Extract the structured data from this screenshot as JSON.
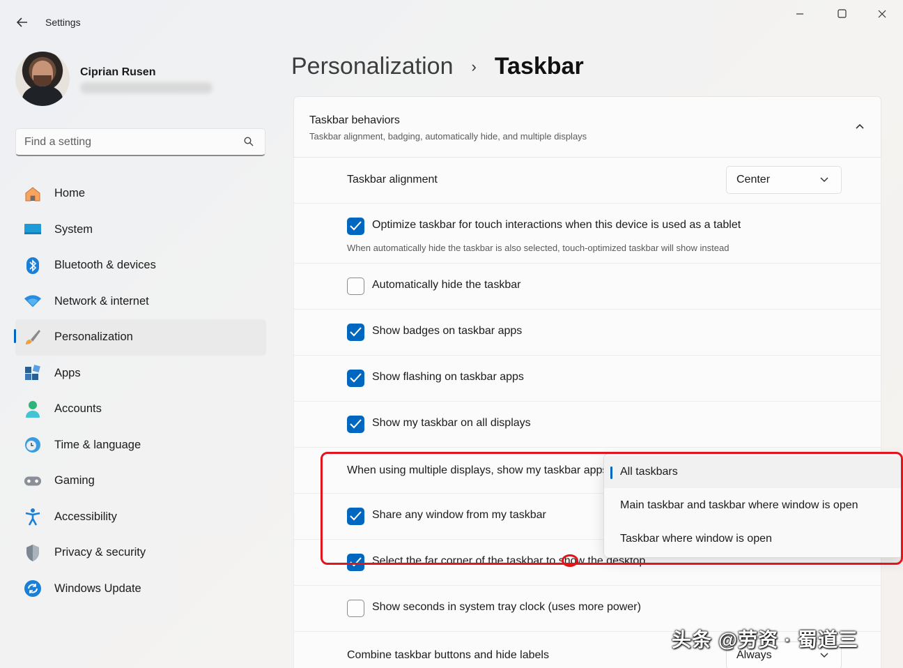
{
  "window": {
    "app_title": "Settings",
    "back_icon": "arrow-left-icon",
    "controls": [
      "minimize-icon",
      "maximize-icon",
      "close-icon"
    ]
  },
  "profile": {
    "name": "Ciprian Rusen"
  },
  "search": {
    "placeholder": "Find a setting",
    "value": ""
  },
  "sidebar": {
    "items": [
      {
        "label": "Home",
        "icon": "home-icon"
      },
      {
        "label": "System",
        "icon": "monitor-icon"
      },
      {
        "label": "Bluetooth & devices",
        "icon": "bluetooth-icon"
      },
      {
        "label": "Network & internet",
        "icon": "wifi-icon"
      },
      {
        "label": "Personalization",
        "icon": "paintbrush-icon",
        "active": true
      },
      {
        "label": "Apps",
        "icon": "apps-icon"
      },
      {
        "label": "Accounts",
        "icon": "person-icon"
      },
      {
        "label": "Time & language",
        "icon": "clock-globe-icon"
      },
      {
        "label": "Gaming",
        "icon": "gamepad-icon"
      },
      {
        "label": "Accessibility",
        "icon": "accessibility-icon"
      },
      {
        "label": "Privacy & security",
        "icon": "shield-icon"
      },
      {
        "label": "Windows Update",
        "icon": "update-icon"
      }
    ]
  },
  "header": {
    "parent": "Personalization",
    "separator": "›",
    "current": "Taskbar"
  },
  "section": {
    "title": "Taskbar behaviors",
    "subtitle": "Taskbar alignment, badging, automatically hide, and multiple displays",
    "rows": {
      "alignment": {
        "label": "Taskbar alignment",
        "value": "Center"
      },
      "touch": {
        "label": "Optimize taskbar for touch interactions when this device is used as a tablet",
        "sub": "When automatically hide the taskbar is also selected, touch-optimized taskbar will show instead",
        "checked": true
      },
      "autohide": {
        "label": "Automatically hide the taskbar",
        "checked": false
      },
      "badges": {
        "label": "Show badges on taskbar apps",
        "checked": true
      },
      "flashing": {
        "label": "Show flashing on taskbar apps",
        "checked": true
      },
      "all_displays": {
        "label": "Show my taskbar on all displays",
        "checked": true
      },
      "multi_display": {
        "label": "When using multiple displays, show my taskbar apps on"
      },
      "share": {
        "label": "Share any window from my taskbar",
        "checked": true
      },
      "corner": {
        "label": "Select the far corner of the taskbar to show the desktop",
        "checked": true
      },
      "seconds": {
        "label": "Show seconds in system tray clock (uses more power)",
        "checked": false
      },
      "combine": {
        "label": "Combine taskbar buttons and hide labels",
        "value": "Always"
      }
    }
  },
  "popup_menu": {
    "options": [
      {
        "label": "All taskbars",
        "selected": true
      },
      {
        "label": "Main taskbar and taskbar where window is open",
        "selected": false
      },
      {
        "label": "Taskbar where window is open",
        "selected": false
      }
    ]
  },
  "watermark": "头条 @劳资 · 蜀道三",
  "colors": {
    "accent": "#0067c0",
    "annotation": "#e3141c"
  }
}
